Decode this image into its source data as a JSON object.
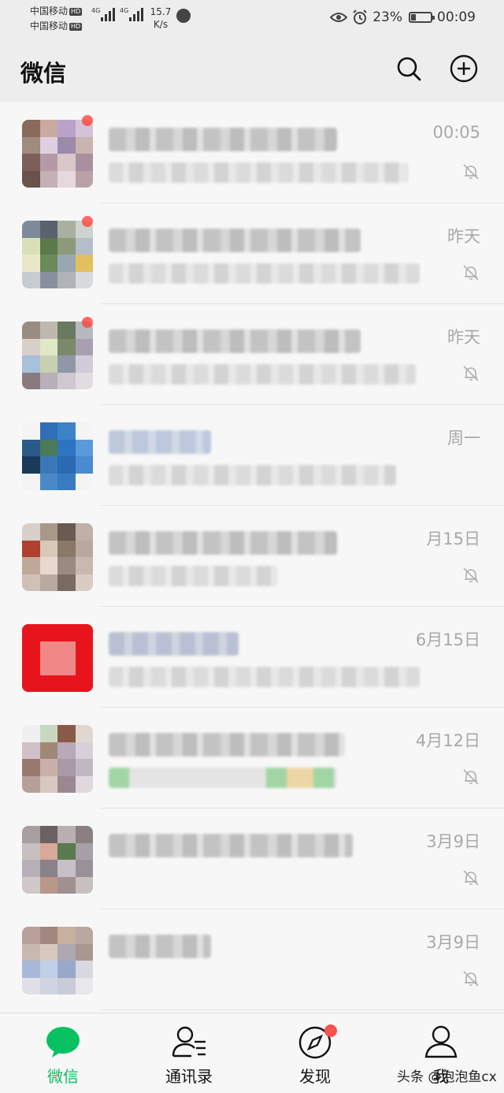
{
  "status_bar": {
    "carrier_1": "中国移动",
    "carrier_2": "中国移动",
    "hd_badge": "HD",
    "network_type": "4G",
    "net_speed_value": "15.7",
    "net_speed_unit": "K/s",
    "battery": "23%",
    "time": "00:09"
  },
  "header": {
    "title": "微信",
    "search_icon": "search-icon",
    "add_icon": "plus-circle-icon"
  },
  "chats": [
    {
      "time": "00:05",
      "muted": true,
      "unread": true
    },
    {
      "time": "昨天",
      "muted": true,
      "unread": true
    },
    {
      "time": "昨天",
      "muted": true,
      "unread": true
    },
    {
      "time": "周一",
      "muted": false,
      "unread": false
    },
    {
      "time": "月15日",
      "muted": true,
      "unread": false
    },
    {
      "time": "6月15日",
      "muted": false,
      "unread": false
    },
    {
      "time": "4月12日",
      "muted": true,
      "unread": false
    },
    {
      "time": "3月9日",
      "muted": true,
      "unread": false
    },
    {
      "time": "3月9日",
      "muted": true,
      "unread": false
    }
  ],
  "tabs": [
    {
      "label": "微信",
      "icon": "chat-bubble-icon",
      "active": true
    },
    {
      "label": "通讯录",
      "icon": "contacts-icon",
      "active": false
    },
    {
      "label": "发现",
      "icon": "compass-icon",
      "active": false
    },
    {
      "label": "我",
      "icon": "person-icon",
      "active": false
    }
  ],
  "watermark": "头条 @泡泡鱼cx",
  "colors": {
    "accent": "#07c160",
    "badge": "#fa5151",
    "background": "#ededed",
    "list_background": "#f7f7f7"
  }
}
